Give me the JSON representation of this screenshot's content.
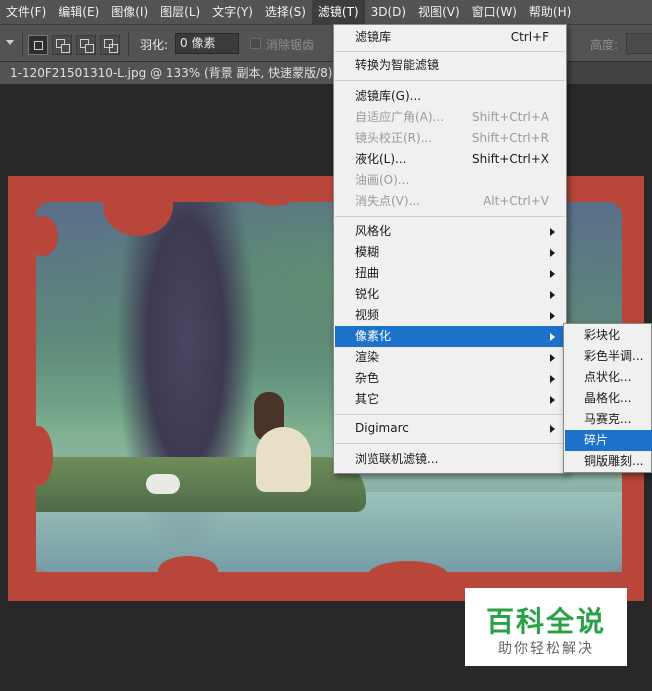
{
  "menubar": {
    "items": [
      "文件(F)",
      "编辑(E)",
      "图像(I)",
      "图层(L)",
      "文字(Y)",
      "选择(S)",
      "滤镜(T)",
      "3D(D)",
      "视图(V)",
      "窗口(W)",
      "帮助(H)"
    ],
    "active": "滤镜(T)"
  },
  "options": {
    "feather_label": "羽化:",
    "feather_value": "0 像素",
    "antialias_label": "消除锯齿",
    "height_label": "高度:"
  },
  "document_tab": {
    "title": "1-120F21501310-L.jpg @ 133% (背景 副本, 快速蒙版/8) *"
  },
  "filter_menu": {
    "filter_gallery_last": {
      "label": "滤镜库",
      "shortcut": "Ctrl+F"
    },
    "convert_smart": {
      "label": "转换为智能滤镜"
    },
    "filter_gallery": {
      "label": "滤镜库(G)..."
    },
    "adaptive_wide_angle": {
      "label": "自适应广角(A)...",
      "shortcut": "Shift+Ctrl+A"
    },
    "lens_correction": {
      "label": "镜头校正(R)...",
      "shortcut": "Shift+Ctrl+R"
    },
    "liquify": {
      "label": "液化(L)...",
      "shortcut": "Shift+Ctrl+X"
    },
    "oil_paint": {
      "label": "油画(O)..."
    },
    "vanishing_point": {
      "label": "消失点(V)...",
      "shortcut": "Alt+Ctrl+V"
    },
    "stylize": {
      "label": "风格化"
    },
    "blur": {
      "label": "模糊"
    },
    "distort": {
      "label": "扭曲"
    },
    "sharpen": {
      "label": "锐化"
    },
    "video": {
      "label": "视频"
    },
    "pixelate": {
      "label": "像素化"
    },
    "render": {
      "label": "渲染"
    },
    "noise": {
      "label": "杂色"
    },
    "other": {
      "label": "其它"
    },
    "digimarc": {
      "label": "Digimarc"
    },
    "browse_online": {
      "label": "浏览联机滤镜..."
    }
  },
  "pixelate_submenu": {
    "items": [
      "彩块化",
      "彩色半调...",
      "点状化...",
      "晶格化...",
      "马赛克...",
      "碎片",
      "铜版雕刻..."
    ],
    "highlighted": "碎片"
  },
  "watermark": {
    "title": "百科全说",
    "subtitle": "助你轻松解决"
  },
  "colors": {
    "menu_highlight": "#1c72c9",
    "mask_red": "#b8463a",
    "watermark_green": "#2aa148"
  }
}
